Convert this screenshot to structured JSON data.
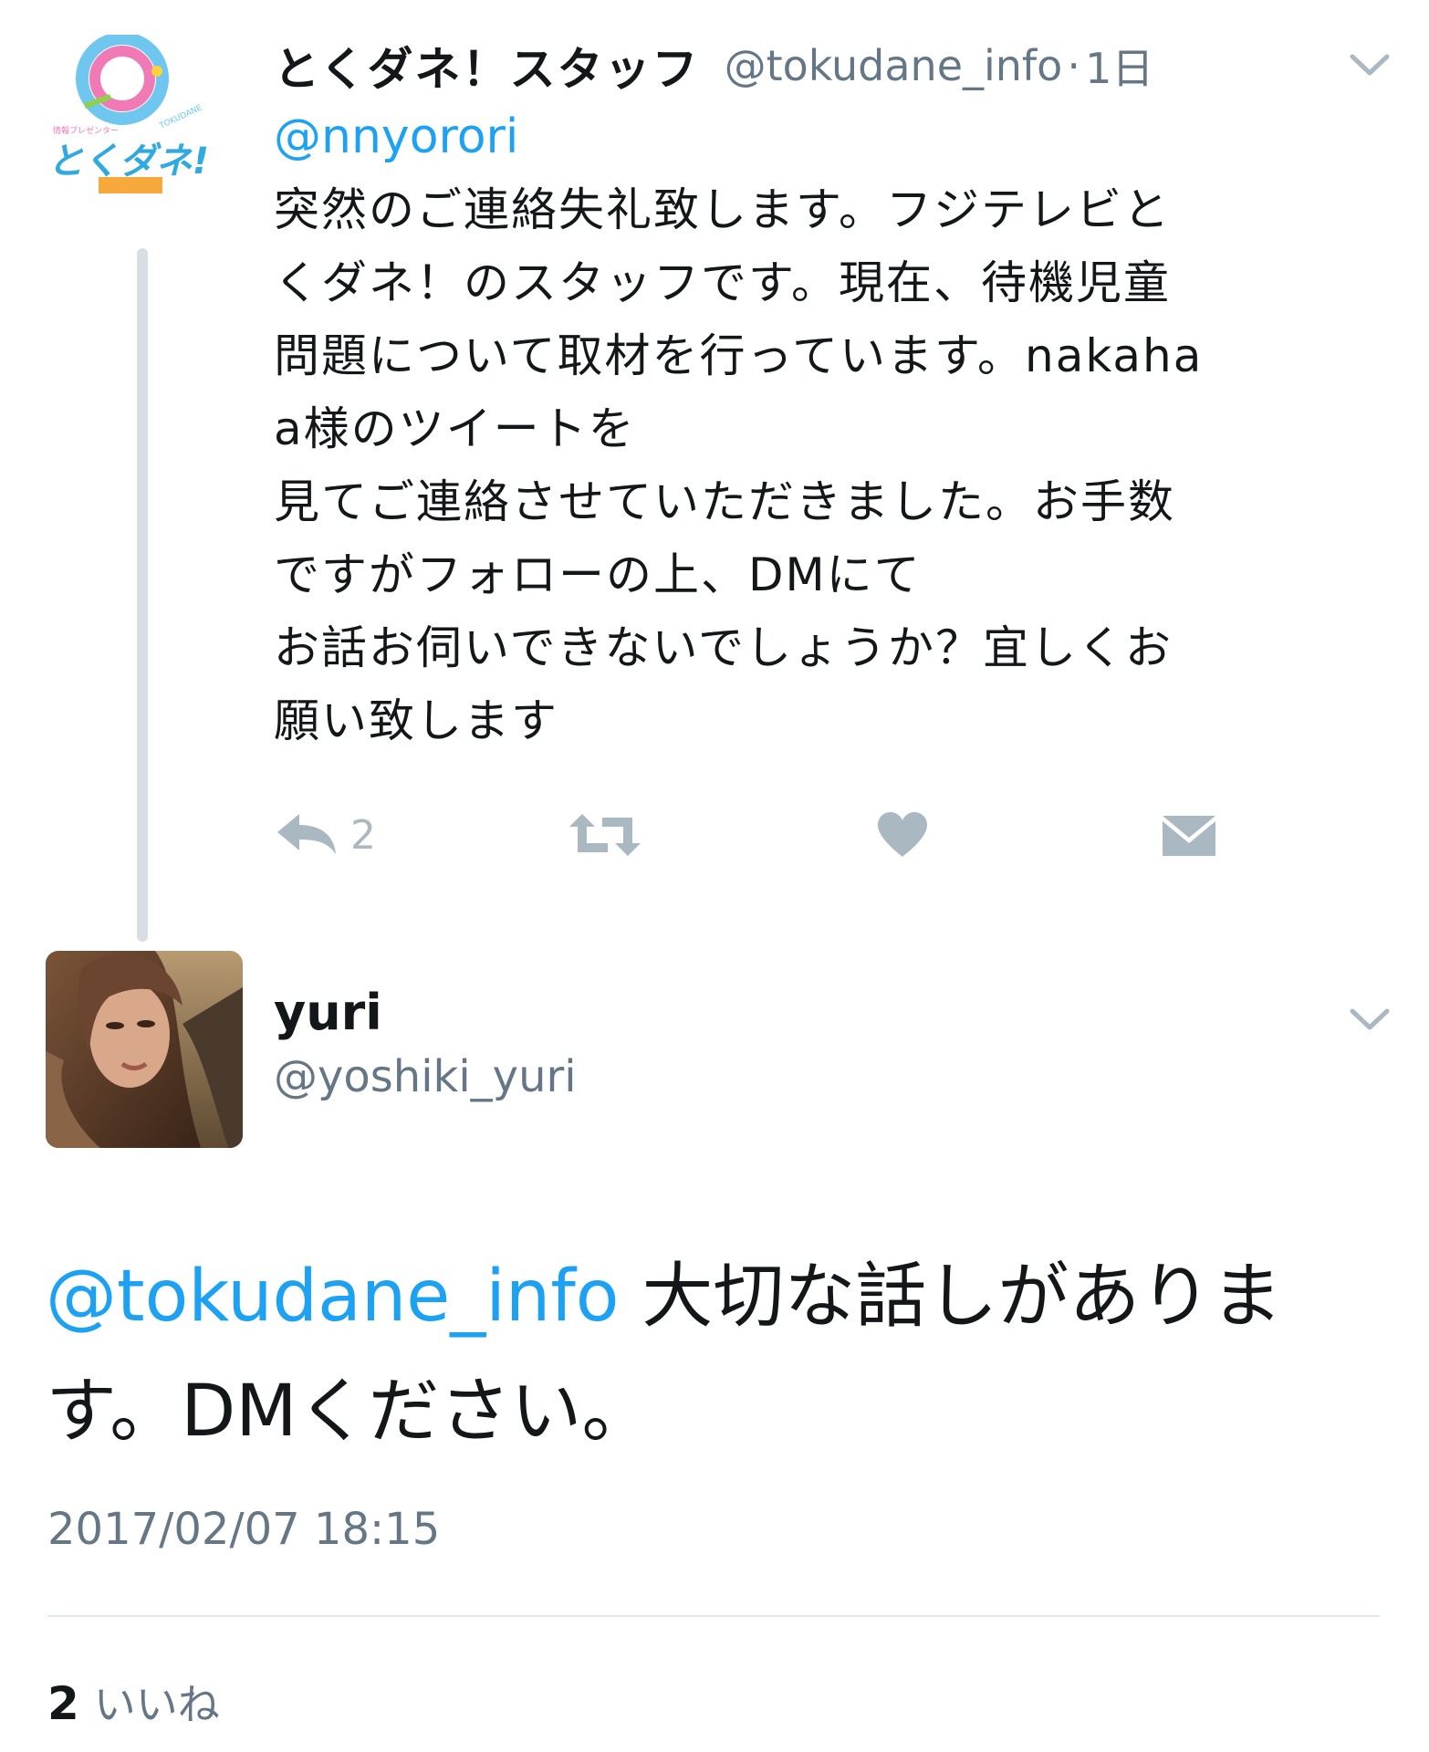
{
  "parent_tweet": {
    "display_name": "とくダネ！スタッフ",
    "handle": "@tokudane_info",
    "separator": "·",
    "time_ago": "1日",
    "mention": "@nnyorori",
    "body_lines": [
      "突然のご連絡失礼致します。フジテレビと",
      "くダネ！のスタッフです。現在、待機児童",
      "問題について取材を行っています。nakaha",
      "a様のツイートを",
      "見てご連絡させていただきました。お手数",
      "ですがフォローの上、DMにて",
      "お話お伺いできないでしょうか？宜しくお",
      "願い致します"
    ],
    "reply_count": "2",
    "icons": {
      "reply": "reply-icon",
      "retweet": "retweet-icon",
      "like": "heart-icon",
      "dm": "envelope-icon",
      "menu": "chevron-down-icon"
    },
    "avatar_logo_text": "とくダネ!"
  },
  "reply_tweet": {
    "display_name": "yuri",
    "handle": "@yoshiki_yuri",
    "mention": "@tokudane_info",
    "text_line1": " 大切な話しがありま",
    "text_line2": "す。DMください。",
    "timestamp": "2017/02/07 18:15",
    "likes_count": "2",
    "likes_label": "いいね"
  },
  "colors": {
    "link_blue": "#1da1f2",
    "secondary_text": "#657786",
    "icon_gray": "#aab8c2",
    "thread_line": "#d8dee4",
    "divider": "#e1e8ed"
  }
}
